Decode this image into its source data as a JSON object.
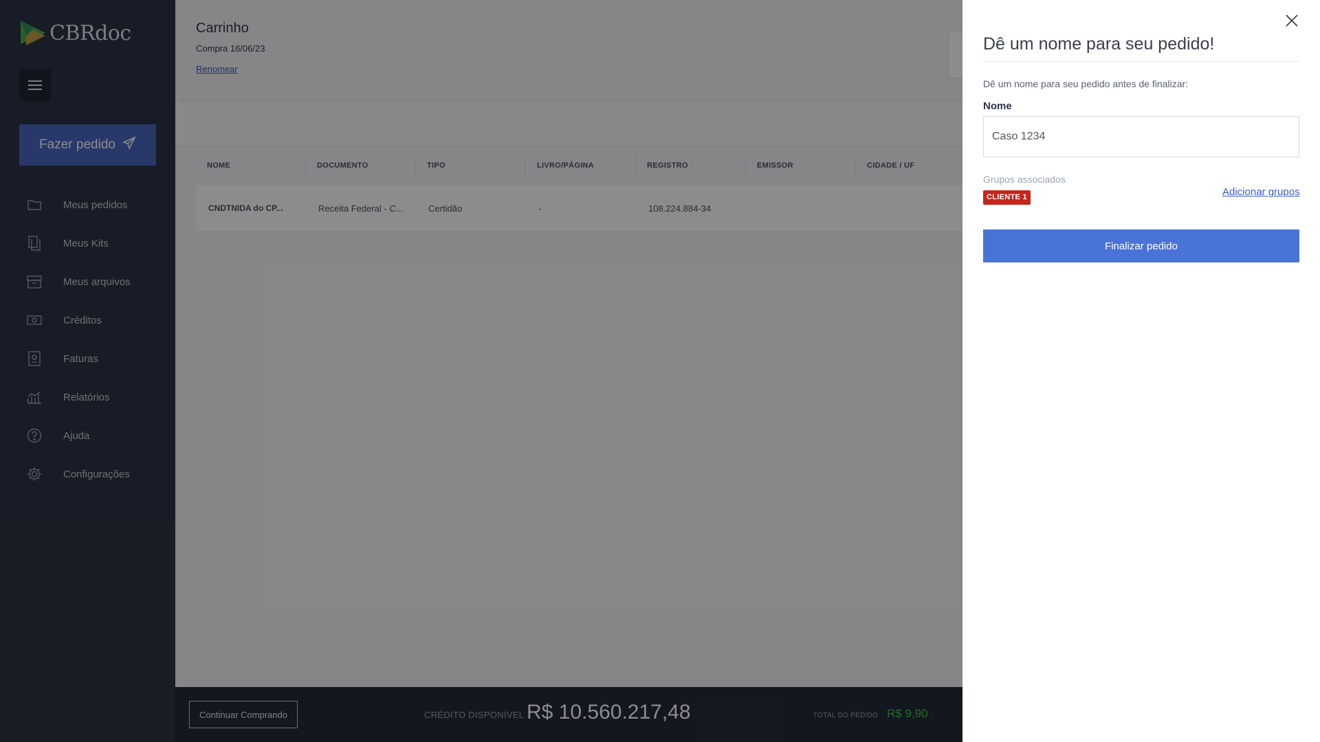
{
  "brand": {
    "name_cbr": "CBR",
    "name_doc": "doc",
    "accent": "#4a67c0",
    "logo_green": "#4fae4f"
  },
  "sidebar": {
    "order_button": "Fazer pedido",
    "items": [
      {
        "label": "Meus pedidos",
        "icon": "folder-icon"
      },
      {
        "label": "Meus Kits",
        "icon": "documents-icon"
      },
      {
        "label": "Meus arquivos",
        "icon": "archive-icon"
      },
      {
        "label": "Créditos",
        "icon": "money-icon"
      },
      {
        "label": "Faturas",
        "icon": "invoice-icon"
      },
      {
        "label": "Relatórios",
        "icon": "chart-icon"
      },
      {
        "label": "Ajuda",
        "icon": "help-icon"
      },
      {
        "label": "Configurações",
        "icon": "gear-icon"
      }
    ]
  },
  "header": {
    "title": "Carrinho",
    "subtitle": "Compra 16/06/23",
    "rename": "Renomear"
  },
  "table": {
    "columns": [
      "NOME",
      "DOCUMENTO",
      "TIPO",
      "LIVRO/PÁGINA",
      "REGISTRO",
      "EMISSOR",
      "CIDADE / UF"
    ],
    "rows": [
      [
        "CNDTNIDA do CP...",
        "Receita Federal - C...",
        "Certidão",
        "-",
        "108.224.884-34",
        "",
        ""
      ]
    ]
  },
  "footer": {
    "continue_button": "Continuar Comprando",
    "credit_label": "CRÉDITO DISPONÍVEL",
    "credit_value": "R$ 10.560.217,48",
    "total_label": "TOTAL DO PEDIDO",
    "total_value": "R$ 9,90"
  },
  "drawer": {
    "title": "Dê um nome para seu pedido!",
    "description": "Dê um nome para seu pedido antes de finalizar:",
    "name_label": "Nome",
    "name_value": "Caso 1234",
    "groups_label": "Grupos associados",
    "group_badge": "CLIENTE 1",
    "add_groups": "Adicionar grupos",
    "finalize_button": "Finalizar pedido"
  }
}
